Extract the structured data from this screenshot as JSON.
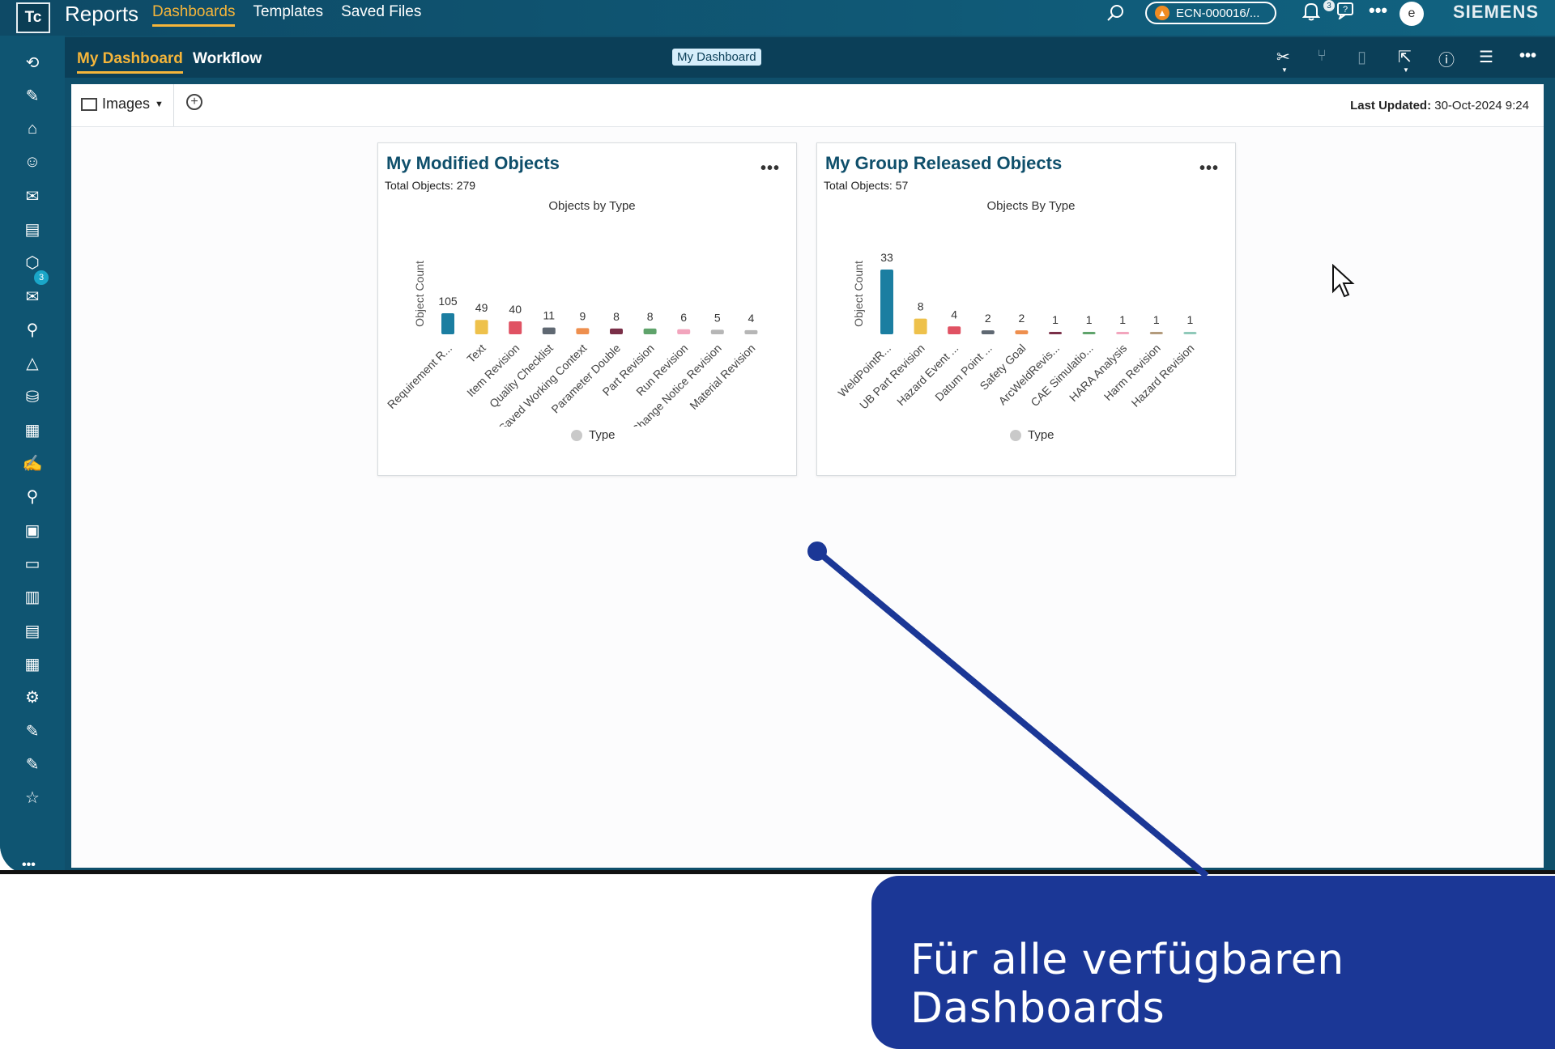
{
  "app": {
    "logo": "Tc",
    "title": "Reports",
    "nav": [
      "Dashboards",
      "Templates",
      "Saved Files"
    ],
    "active_nav": "Dashboards",
    "ecn_label": "ECN-000016/...",
    "notification_count": "3",
    "avatar_initial": "e",
    "brand": "SIEMENS"
  },
  "rail": {
    "badge_count": "3",
    "icons": [
      "back-icon",
      "edit-icon",
      "home-icon",
      "robot-icon",
      "chat-icon",
      "folder-icon",
      "cube-icon",
      "inbox-icon",
      "stamp-icon",
      "triangle-icon",
      "layers-icon",
      "doc-check-icon",
      "doc-pen-icon",
      "stamp2-icon",
      "image-doc-icon",
      "folder2-icon",
      "card-icon",
      "report-icon",
      "table-icon",
      "settings-icon",
      "audit-icon",
      "edit2-icon",
      "star-icon"
    ]
  },
  "subheader": {
    "tabs": [
      "My Dashboard",
      "Workflow"
    ],
    "chip": "My Dashboard"
  },
  "toolbar": {
    "images_label": "Images",
    "last_updated_label": "Last Updated:",
    "last_updated_value": "30-Oct-2024 9:24"
  },
  "cards": [
    {
      "title": "My Modified Objects",
      "subtitle": "Total Objects: 279",
      "legend": "Type"
    },
    {
      "title": "My Group Released Objects",
      "subtitle": "Total Objects: 57",
      "legend": "Type"
    }
  ],
  "chart_data": [
    {
      "type": "bar",
      "title": "Objects by Type",
      "ylabel": "Object Count",
      "categories": [
        "Requirement R...",
        "Text",
        "Item Revision",
        "Quality Checklist",
        "Saved Working Context",
        "Parameter Double",
        "Part Revision",
        "Run Revision",
        "Change Notice Revision",
        "Material Revision"
      ],
      "values": [
        105,
        49,
        40,
        11,
        9,
        8,
        8,
        6,
        5,
        4
      ],
      "colors": [
        "#1b7ea1",
        "#eec14b",
        "#e05263",
        "#5f6872",
        "#ee8f4e",
        "#7a2f48",
        "#5fa36b",
        "#f2a5bd",
        "#b6b6b6",
        "#b6b6b6"
      ],
      "legend": "Type",
      "legend_position": "bottom"
    },
    {
      "type": "bar",
      "title": "Objects By Type",
      "ylabel": "Object Count",
      "categories": [
        "WeldPointR...",
        "UB Part Revision",
        "Hazard Event ...",
        "Datum Point ...",
        "Safety Goal",
        "ArcWeldRevis...",
        "CAE Simulatio...",
        "HARA Analysis",
        "Harm Revision",
        "Hazard Revision"
      ],
      "values": [
        33,
        8,
        4,
        2,
        2,
        1,
        1,
        1,
        1,
        1
      ],
      "colors": [
        "#1b7ea1",
        "#eec14b",
        "#e05263",
        "#5f6872",
        "#ee8f4e",
        "#7a2f48",
        "#5fa36b",
        "#f2a5bd",
        "#b39b7c",
        "#8fc9b9"
      ],
      "legend": "Type",
      "legend_position": "bottom"
    }
  ],
  "caption": "Für alle verfügbaren Dashboards"
}
